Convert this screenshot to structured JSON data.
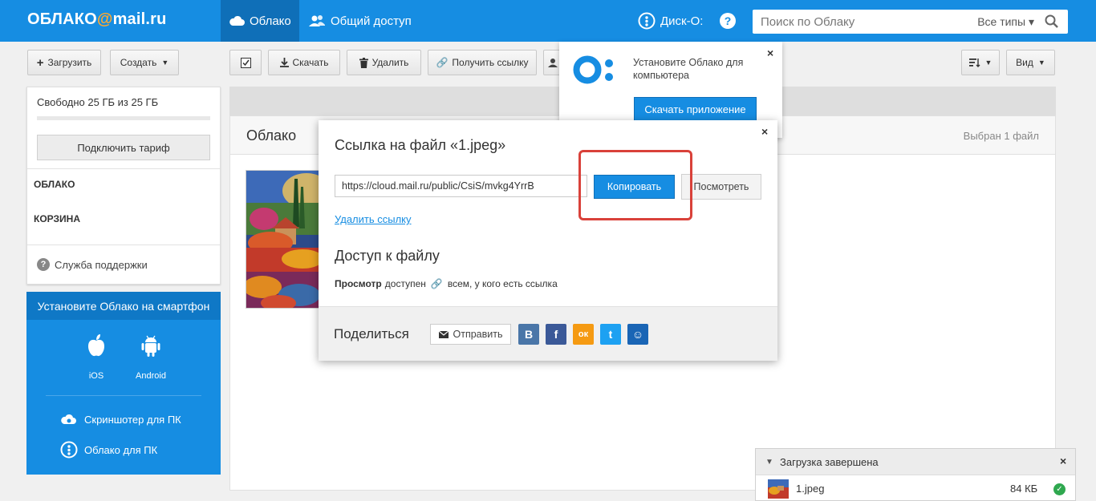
{
  "header": {
    "logo_part1": "ОБЛАКО",
    "logo_at": "@",
    "logo_part2": "mail.ru",
    "tab_cloud": "Облако",
    "tab_shared": "Общий доступ",
    "disk_o": "Диск-О:",
    "help": "?",
    "search_placeholder": "Поиск по Облаку",
    "search_types": "Все типы"
  },
  "toolbar": {
    "upload": "Загрузить",
    "create": "Создать",
    "download": "Скачать",
    "delete": "Удалить",
    "get_link": "Получить ссылку",
    "view": "Вид"
  },
  "sidebar": {
    "free_space": "Свободно 25 ГБ из 25 ГБ",
    "used_fraction": 0,
    "tariff_button": "Подключить тариф",
    "items": [
      "ОБЛАКО",
      "КОРЗИНА"
    ],
    "support": "Служба поддержки"
  },
  "phone_card": {
    "title": "Установите Облако на смартфон",
    "ios": "iOS",
    "android": "Android",
    "screenshoter": "Скриншотер для ПК",
    "cloud_pc": "Облако для ПК"
  },
  "main": {
    "title": "Облако",
    "selected": "Выбран 1 файл"
  },
  "install_popup": {
    "text": "Установите Облако для компьютера",
    "button": "Скачать приложение"
  },
  "modal": {
    "title": "Ссылка на файл «1.jpeg»",
    "link_value": "https://cloud.mail.ru/public/CsiS/mvkg4YrrB",
    "copy_button": "Копировать",
    "view_button": "Посмотреть",
    "delete_link": "Удалить ссылку",
    "access_title": "Доступ к файлу",
    "perm_bold": "Просмотр",
    "perm_rest": "доступен",
    "perm_who": "всем, у кого есть ссылка",
    "share_label": "Поделиться",
    "send_button": "Отправить",
    "social": [
      {
        "name": "vk",
        "glyph": "В",
        "color": "#4a76a8"
      },
      {
        "name": "facebook",
        "glyph": "f",
        "color": "#3b5998"
      },
      {
        "name": "odnoklassniki",
        "glyph": "ок",
        "color": "#f59a12"
      },
      {
        "name": "twitter",
        "glyph": "t",
        "color": "#1da1f2"
      },
      {
        "name": "moi-mir",
        "glyph": "☺",
        "color": "#1a65b5"
      }
    ]
  },
  "upload_notice": {
    "title": "Загрузка завершена",
    "file_name": "1.jpeg",
    "file_size": "84 КБ"
  },
  "colors": {
    "brand": "#168de2",
    "accent_at": "#ffa930",
    "highlight": "#d9413a"
  }
}
